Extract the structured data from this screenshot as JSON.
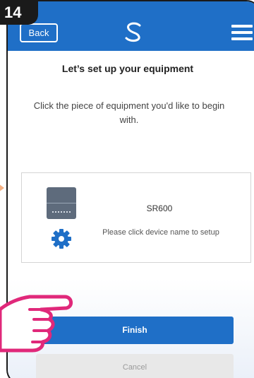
{
  "step": "14",
  "header": {
    "back_label": "Back",
    "logo_icon": "salus-logo-icon",
    "menu_icon": "hamburger-menu-icon",
    "color": "#1f6fc7"
  },
  "page": {
    "title": "Let’s set up your equipment",
    "subtitle": "Click the piece of equipment you'd like to begin with."
  },
  "device": {
    "name": "SR600",
    "hint": "Please click device name to setup",
    "thumb_icon": "device-thumbnail",
    "settings_icon": "gear-icon"
  },
  "actions": {
    "finish_label": "Finish",
    "cancel_label": "Cancel"
  }
}
